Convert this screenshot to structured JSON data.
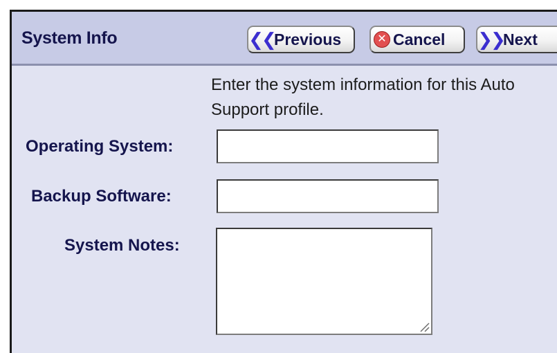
{
  "header": {
    "title": "System Info",
    "buttons": {
      "previous": {
        "label": "Previous",
        "icon": "double-chevron-left-icon"
      },
      "cancel": {
        "label": "Cancel",
        "icon": "cancel-circle-icon"
      },
      "next": {
        "label": "Next",
        "icon": "double-chevron-right-icon"
      }
    }
  },
  "form": {
    "instructions": "Enter the system information for this Auto Support profile.",
    "operating_system": {
      "label": "Operating System:",
      "value": ""
    },
    "backup_software": {
      "label": "Backup Software:",
      "value": ""
    },
    "system_notes": {
      "label": "System Notes:",
      "value": ""
    }
  },
  "colors": {
    "panel_background": "#e1e3f2",
    "titlebar_background": "#c7cbe6",
    "label_text": "#15154d",
    "nav_arrow": "#3b2ecf",
    "cancel_icon": "#e25050"
  }
}
